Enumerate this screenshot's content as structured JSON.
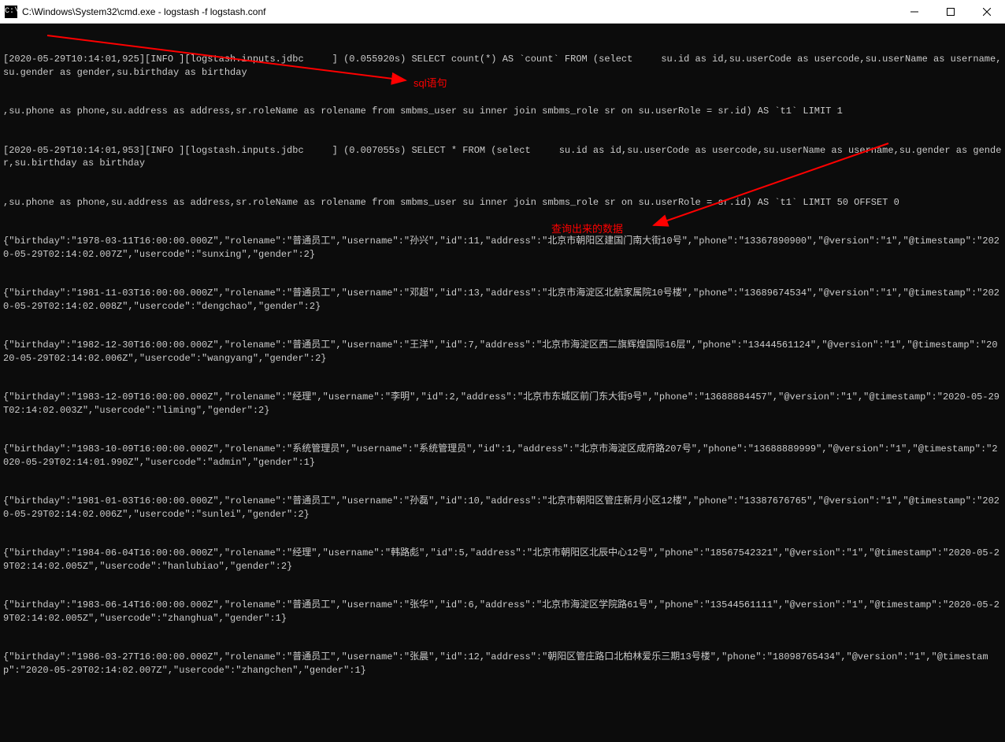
{
  "title": "C:\\Windows\\System32\\cmd.exe - logstash  -f logstash.conf",
  "icon_text": "C:\\",
  "annotations": {
    "sql_label": "sql语句",
    "data_label": "查询出来的数据"
  },
  "lines": [
    "[2020-05-29T10:14:01,925][INFO ][logstash.inputs.jdbc     ] (0.055920s) SELECT count(*) AS `count` FROM (select     su.id as id,su.userCode as usercode,su.userName as username,su.gender as gender,su.birthday as birthday",
    ",su.phone as phone,su.address as address,sr.roleName as rolename from smbms_user su inner join smbms_role sr on su.userRole = sr.id) AS `t1` LIMIT 1",
    "[2020-05-29T10:14:01,953][INFO ][logstash.inputs.jdbc     ] (0.007055s) SELECT * FROM (select     su.id as id,su.userCode as usercode,su.userName as username,su.gender as gender,su.birthday as birthday",
    ",su.phone as phone,su.address as address,sr.roleName as rolename from smbms_user su inner join smbms_role sr on su.userRole = sr.id) AS `t1` LIMIT 50 OFFSET 0",
    "{\"birthday\":\"1978-03-11T16:00:00.000Z\",\"rolename\":\"普通员工\",\"username\":\"孙兴\",\"id\":11,\"address\":\"北京市朝阳区建国门南大街10号\",\"phone\":\"13367890900\",\"@version\":\"1\",\"@timestamp\":\"2020-05-29T02:14:02.007Z\",\"usercode\":\"sunxing\",\"gender\":2}",
    "{\"birthday\":\"1981-11-03T16:00:00.000Z\",\"rolename\":\"普通员工\",\"username\":\"邓超\",\"id\":13,\"address\":\"北京市海淀区北航家属院10号楼\",\"phone\":\"13689674534\",\"@version\":\"1\",\"@timestamp\":\"2020-05-29T02:14:02.008Z\",\"usercode\":\"dengchao\",\"gender\":2}",
    "{\"birthday\":\"1982-12-30T16:00:00.000Z\",\"rolename\":\"普通员工\",\"username\":\"王洋\",\"id\":7,\"address\":\"北京市海淀区西二旗辉煌国际16层\",\"phone\":\"13444561124\",\"@version\":\"1\",\"@timestamp\":\"2020-05-29T02:14:02.006Z\",\"usercode\":\"wangyang\",\"gender\":2}",
    "{\"birthday\":\"1983-12-09T16:00:00.000Z\",\"rolename\":\"经理\",\"username\":\"李明\",\"id\":2,\"address\":\"北京市东城区前门东大街9号\",\"phone\":\"13688884457\",\"@version\":\"1\",\"@timestamp\":\"2020-05-29T02:14:02.003Z\",\"usercode\":\"liming\",\"gender\":2}",
    "{\"birthday\":\"1983-10-09T16:00:00.000Z\",\"rolename\":\"系统管理员\",\"username\":\"系统管理员\",\"id\":1,\"address\":\"北京市海淀区成府路207号\",\"phone\":\"13688889999\",\"@version\":\"1\",\"@timestamp\":\"2020-05-29T02:14:01.990Z\",\"usercode\":\"admin\",\"gender\":1}",
    "{\"birthday\":\"1981-01-03T16:00:00.000Z\",\"rolename\":\"普通员工\",\"username\":\"孙磊\",\"id\":10,\"address\":\"北京市朝阳区管庄新月小区12楼\",\"phone\":\"13387676765\",\"@version\":\"1\",\"@timestamp\":\"2020-05-29T02:14:02.006Z\",\"usercode\":\"sunlei\",\"gender\":2}",
    "{\"birthday\":\"1984-06-04T16:00:00.000Z\",\"rolename\":\"经理\",\"username\":\"韩路彪\",\"id\":5,\"address\":\"北京市朝阳区北辰中心12号\",\"phone\":\"18567542321\",\"@version\":\"1\",\"@timestamp\":\"2020-05-29T02:14:02.005Z\",\"usercode\":\"hanlubiao\",\"gender\":2}",
    "{\"birthday\":\"1983-06-14T16:00:00.000Z\",\"rolename\":\"普通员工\",\"username\":\"张华\",\"id\":6,\"address\":\"北京市海淀区学院路61号\",\"phone\":\"13544561111\",\"@version\":\"1\",\"@timestamp\":\"2020-05-29T02:14:02.005Z\",\"usercode\":\"zhanghua\",\"gender\":1}",
    "{\"birthday\":\"1986-03-27T16:00:00.000Z\",\"rolename\":\"普通员工\",\"username\":\"张晨\",\"id\":12,\"address\":\"朝阳区管庄路口北柏林爱乐三期13号楼\",\"phone\":\"18098765434\",\"@version\":\"1\",\"@timestamp\":\"2020-05-29T02:14:02.007Z\",\"usercode\":\"zhangchen\",\"gender\":1}"
  ]
}
